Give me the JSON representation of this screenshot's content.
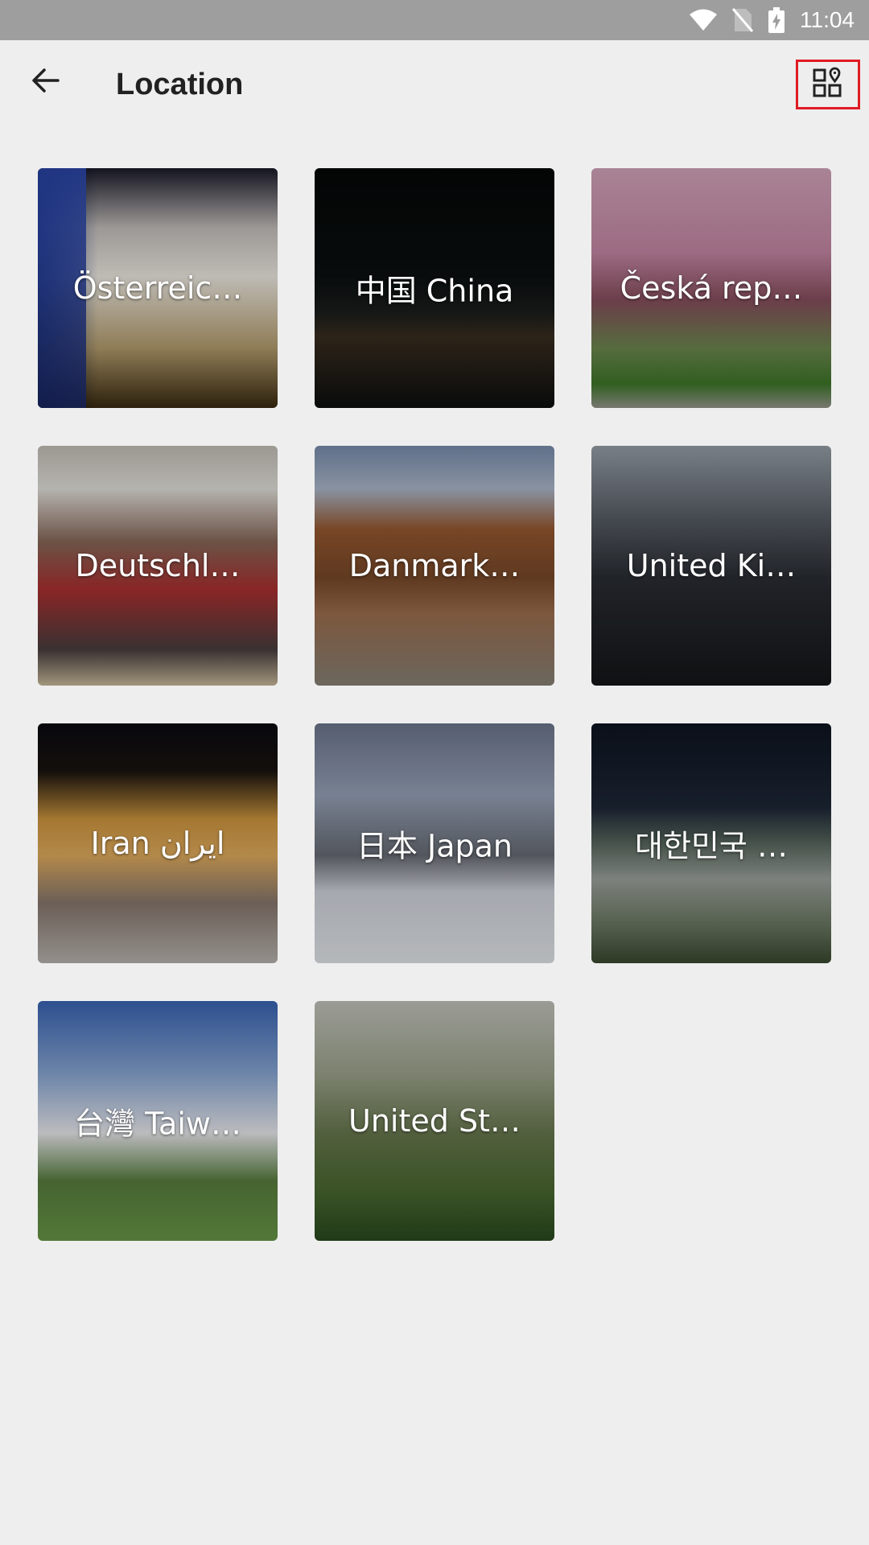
{
  "status_bar": {
    "time": "11:04",
    "icons": [
      "wifi-icon",
      "no-sim-icon",
      "battery-charging-icon"
    ]
  },
  "app_bar": {
    "back_icon": "arrow-back-icon",
    "title": "Location",
    "layout_icon": "grid-pin-icon"
  },
  "locations": [
    {
      "label": "Österreic…"
    },
    {
      "label": "中国 China"
    },
    {
      "label": "Česká rep…"
    },
    {
      "label": "Deutschl…"
    },
    {
      "label": "Danmark…"
    },
    {
      "label": "United Ki…"
    },
    {
      "label": "Iran ایران"
    },
    {
      "label": "日本 Japan"
    },
    {
      "label": "대한민국 …"
    },
    {
      "label": "台灣 Taiw…"
    },
    {
      "label": "United St…"
    }
  ],
  "colors": {
    "background": "#eeeeee",
    "status_bar": "#9e9e9e",
    "highlight": "#e01b24"
  }
}
